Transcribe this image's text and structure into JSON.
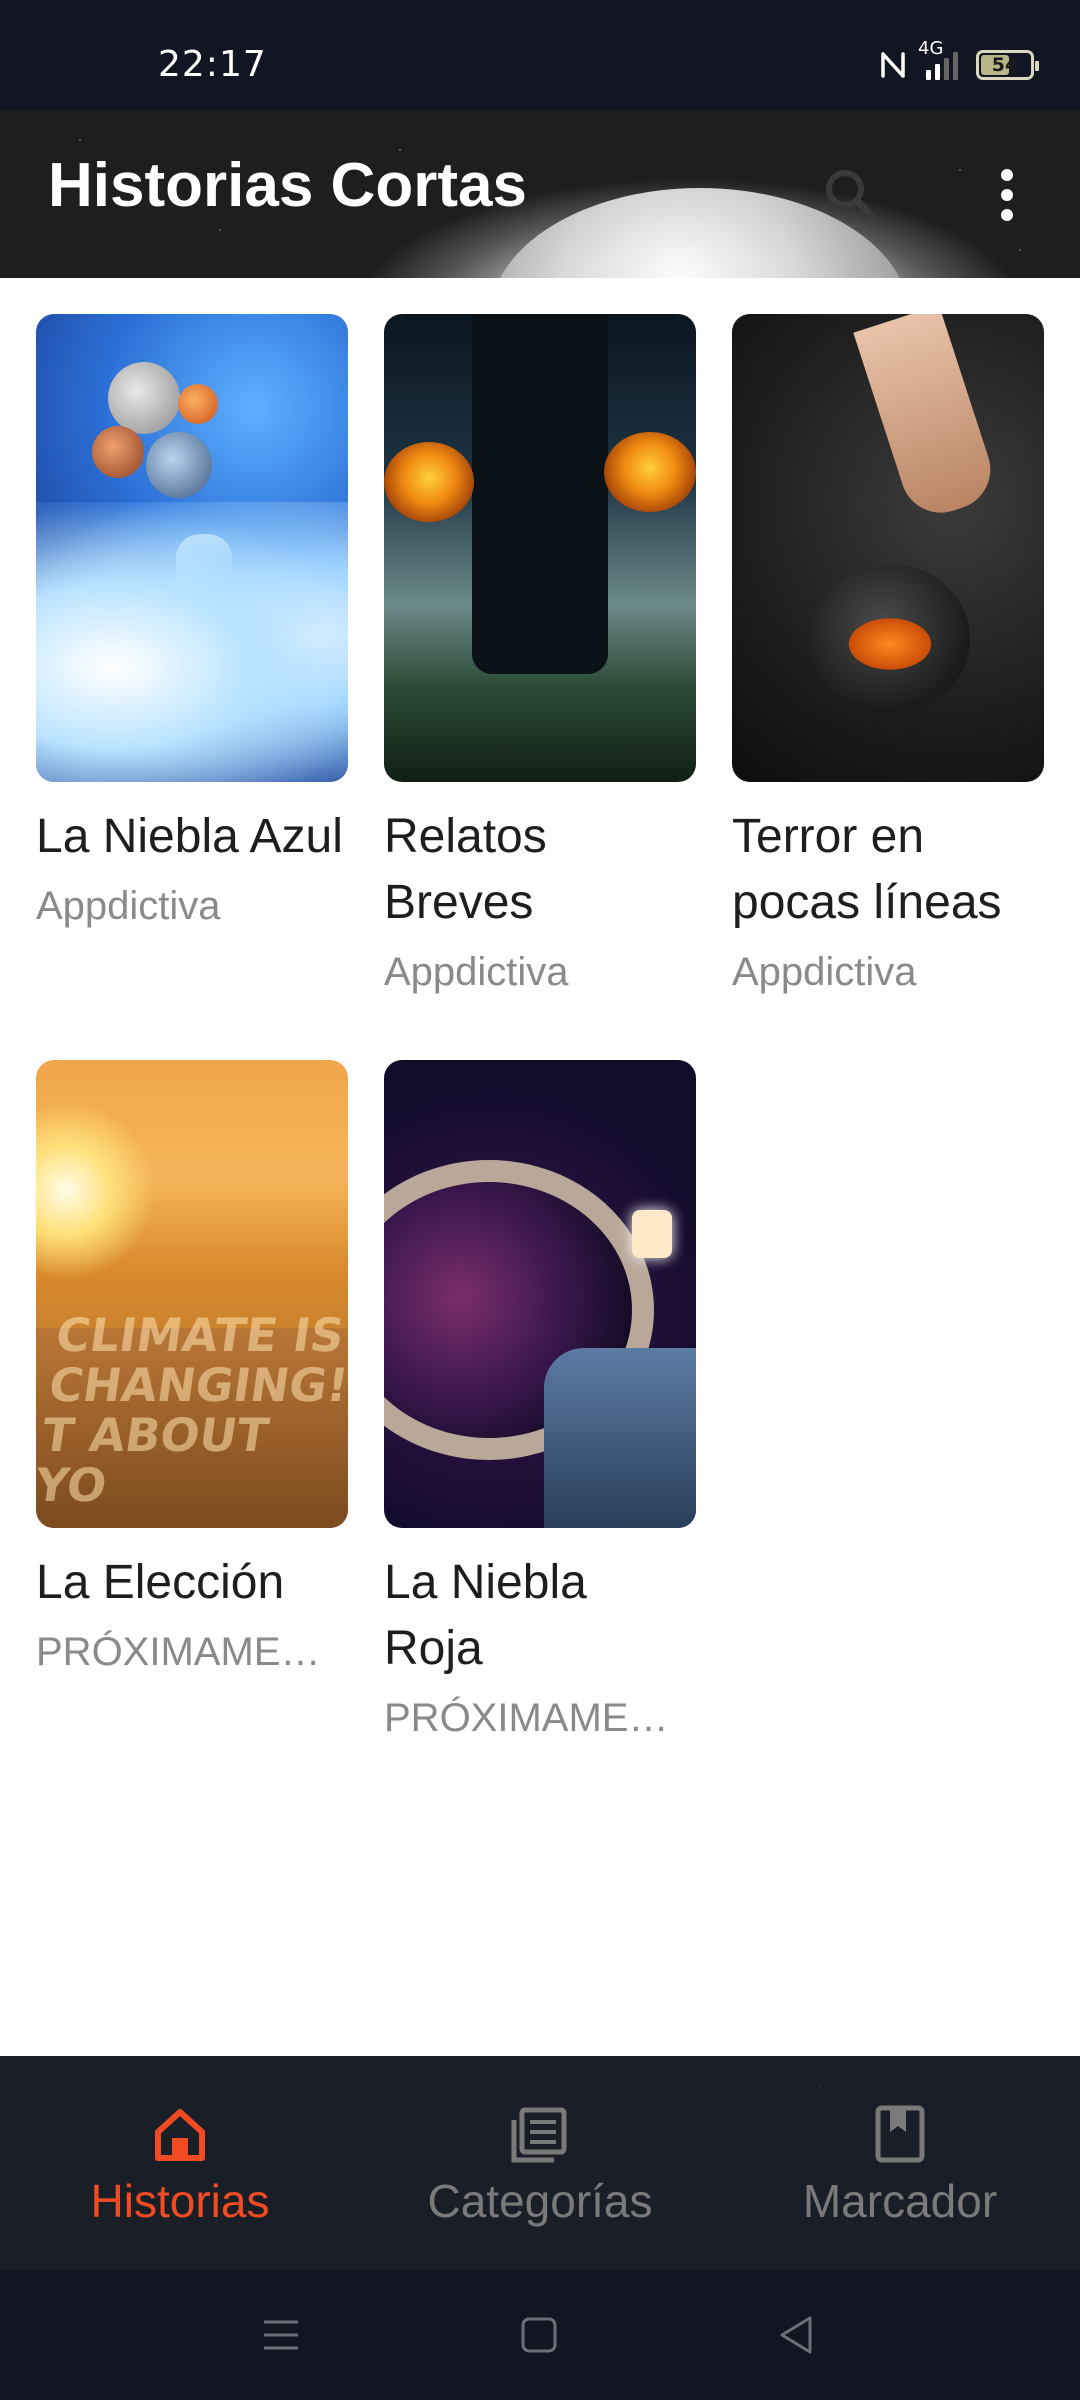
{
  "status_bar": {
    "time": "22:17",
    "network": "4G",
    "battery": "54",
    "battery_level": 0.54
  },
  "header": {
    "title": "Historias Cortas",
    "search_icon": "search-icon",
    "more_icon": "more-vert-icon"
  },
  "stories": [
    {
      "title": "La Niebla Azul",
      "author": "Appdictiva"
    },
    {
      "title": "Relatos Breves",
      "author": "Appdictiva"
    },
    {
      "title": "Terror en pocas líneas",
      "author": "Appdictiva"
    },
    {
      "title": "La Elección",
      "author": "PRÓXIMAMENTE"
    },
    {
      "title": "La Niebla Roja",
      "author": "PRÓXIMAMENTE"
    }
  ],
  "cover_text": {
    "election_road_lines": [
      "CLIMATE IS",
      "CHANGING!",
      "T ABOUT YO"
    ]
  },
  "bottom_nav": {
    "items": [
      {
        "label": "Historias",
        "icon": "home-icon",
        "active": true
      },
      {
        "label": "Categorías",
        "icon": "list-icon",
        "active": false
      },
      {
        "label": "Marcador",
        "icon": "bookmark-icon",
        "active": false
      }
    ]
  },
  "colors": {
    "accent": "#f04b22",
    "nav_bg": "#1a1e27",
    "status_bg": "#121622"
  }
}
